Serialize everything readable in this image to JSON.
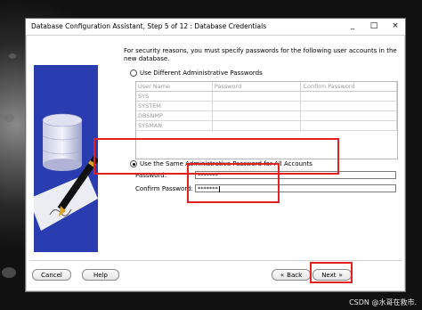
{
  "window": {
    "title": "Database Configuration Assistant, Step 5 of 12 : Database Credentials",
    "controls": [
      "_",
      "□",
      "×"
    ]
  },
  "description": "For security reasons, you must specify passwords for the following user accounts in the new database.",
  "option_different": "Use Different Administrative Passwords",
  "table": {
    "columns": [
      "User Name",
      "Password",
      "Confirm Password"
    ],
    "rows": [
      "SYS",
      "SYSTEM",
      "DBSNMP",
      "SYSMAN"
    ]
  },
  "option_same": "Use the Same Administrative Password for All Accounts",
  "password_label": "Password:",
  "password_value": "*******",
  "confirm_label": "Confirm Password:",
  "confirm_value": "*******",
  "buttons": {
    "cancel": "Cancel",
    "help": "Help",
    "back": "Back",
    "back_icon": "«",
    "next": "Next",
    "next_icon": "»"
  },
  "watermark": "CSDN @水哥在救市."
}
